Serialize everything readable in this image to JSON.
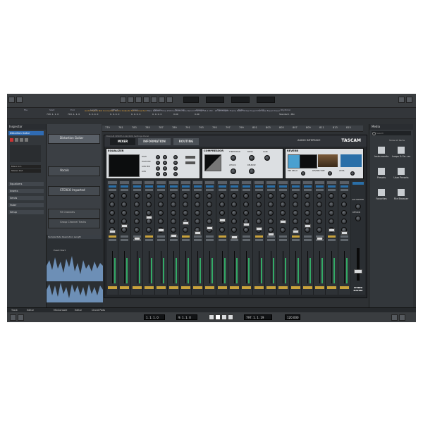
{
  "toolbar": {
    "headers": [
      "File",
      "Start",
      "End",
      "Length",
      "Offset",
      "Snap",
      "Fade-In",
      "Fade-Out",
      "Volume",
      "Transpose",
      "Mute",
      "Lock",
      "Rhythmic"
    ],
    "status": [
      "Audio Inputs",
      "Not Connected",
      "Audio Outputs",
      "Not Connected",
      "Max. Record Time",
      "236 hours 41 mins",
      "Record Format",
      "96.1 kHz - 24 bit",
      "Project Frame Rate",
      "30 fps",
      "Project Pan Law",
      "Equal Power"
    ],
    "values": [
      "718. 1. 1. 0",
      "718. 1. 1. 0",
      "0. 0. 0. 0",
      "0. 0. 0. 0",
      "0. 0. 0. 0",
      "0. 0. 0. 0",
      "0.00",
      "0.00",
      "Standard - Mix"
    ]
  },
  "ruler": {
    "numbers": [
      "779",
      "781",
      "783",
      "785",
      "787",
      "789",
      "791",
      "793",
      "795",
      "797",
      "799",
      "801",
      "803",
      "805",
      "807",
      "809",
      "811",
      "813",
      "815"
    ]
  },
  "inspector": {
    "title": "Inspector",
    "track_name": "Distortion Guitar",
    "routing_in": "Mono In 1",
    "routing_out": "Stereo Out",
    "sections": [
      "Equalizers",
      "Inserts",
      "Sends",
      "Fader",
      "Setup"
    ]
  },
  "tracks": [
    {
      "name": "Distortion Guitar"
    },
    {
      "name": "Vocals"
    },
    {
      "name": "STEREO Imported"
    },
    {
      "name": "FX Channels"
    },
    {
      "name": "Group Channel Tracks"
    }
  ],
  "editor": {
    "labels": [
      "Sample Rate",
      "Resolution",
      "Length"
    ],
    "clip": "Event Start"
  },
  "mixer": {
    "window_title": "TASCAM SERIES 102i/208i Settings Panel",
    "tabs": [
      {
        "label": "MIXER"
      },
      {
        "label": "INFORMATION"
      },
      {
        "label": "ROUTING"
      }
    ],
    "right_label": "AUDIO INTERFACE",
    "brand": "TASCAM",
    "sections": {
      "eq": {
        "title": "EQUALIZER",
        "bands": [
          "HIGH",
          "HIGH MID",
          "LOW MID",
          "LOW"
        ]
      },
      "comp": {
        "title": "COMPRESSOR",
        "params": [
          "THRESHOLD",
          "RATIO",
          "GAIN",
          "ATTACK",
          "RELEASE"
        ]
      },
      "reverb": {
        "title": "REVERB",
        "params": [
          "PRE DELAY",
          "REVERB TIME",
          "LEVEL"
        ]
      }
    },
    "channel_count": 20,
    "master_labels": [
      "AUX MASTER",
      "RETURN",
      "STEREO MASTER"
    ]
  },
  "media": {
    "title": "Media",
    "search_placeholder": "Search",
    "show_all": "Show All Items",
    "tiles": [
      {
        "label": "Instruments",
        "icon": "instruments-icon"
      },
      {
        "label": "Loops & Sa...es",
        "icon": "loops-icon"
      },
      {
        "label": "Presets",
        "icon": "presets-icon"
      },
      {
        "label": "User Presets",
        "icon": "user-presets-icon"
      },
      {
        "label": "Favorites",
        "icon": "favorites-icon"
      },
      {
        "label": "File Browser",
        "icon": "file-browser-icon"
      }
    ]
  },
  "bottom_tabs": [
    {
      "label": "Track"
    },
    {
      "label": "Editor"
    },
    {
      "label": "MixConsole"
    },
    {
      "label": "Editor"
    },
    {
      "label": "Chord Pads"
    }
  ],
  "transport": {
    "left_locator": "1. 1. 1. 0",
    "right_locator": "9. 1. 1. 0",
    "position": "797. 1. 1. 19",
    "tempo": "120.000"
  },
  "colors": {
    "accent": "#c9a23c",
    "panel": "#2e3134",
    "mixer": "#24272a"
  }
}
